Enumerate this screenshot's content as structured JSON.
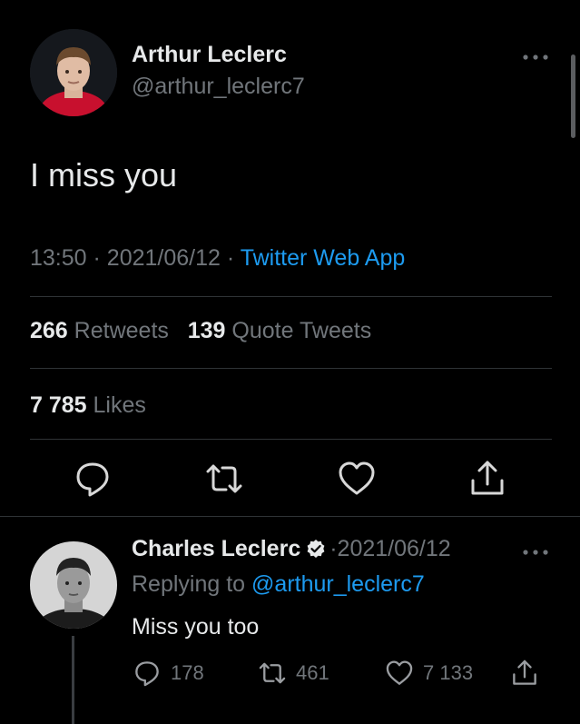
{
  "tweet": {
    "author_name": "Arthur Leclerc",
    "author_handle": "@arthur_leclerc7",
    "text": "I miss you",
    "time": "13:50",
    "date": "2021/06/12",
    "source": "Twitter Web App",
    "retweets_count": "266",
    "retweets_label": "Retweets",
    "quotes_count": "139",
    "quotes_label": "Quote Tweets",
    "likes_count": "7 785",
    "likes_label": "Likes",
    "meta_sep": "·"
  },
  "reply": {
    "author_name": "Charles Leclerc",
    "date": "2021/06/12",
    "replying_prefix": "Replying to",
    "replying_mention": "@arthur_leclerc7",
    "text": "Miss you too",
    "reply_count": "178",
    "retweet_count": "461",
    "like_count": "7 133",
    "sep": "·"
  },
  "icons": {
    "more": "more-horizontal-icon",
    "reply": "speech-bubble-icon",
    "retweet": "retweet-arrows-icon",
    "like": "heart-icon",
    "share": "share-upload-icon",
    "verified": "verified-badge-icon"
  },
  "colors": {
    "background": "#000000",
    "text": "#e7e9ea",
    "muted": "#71767b",
    "link": "#1d9bf0",
    "divider": "#2f3336"
  }
}
